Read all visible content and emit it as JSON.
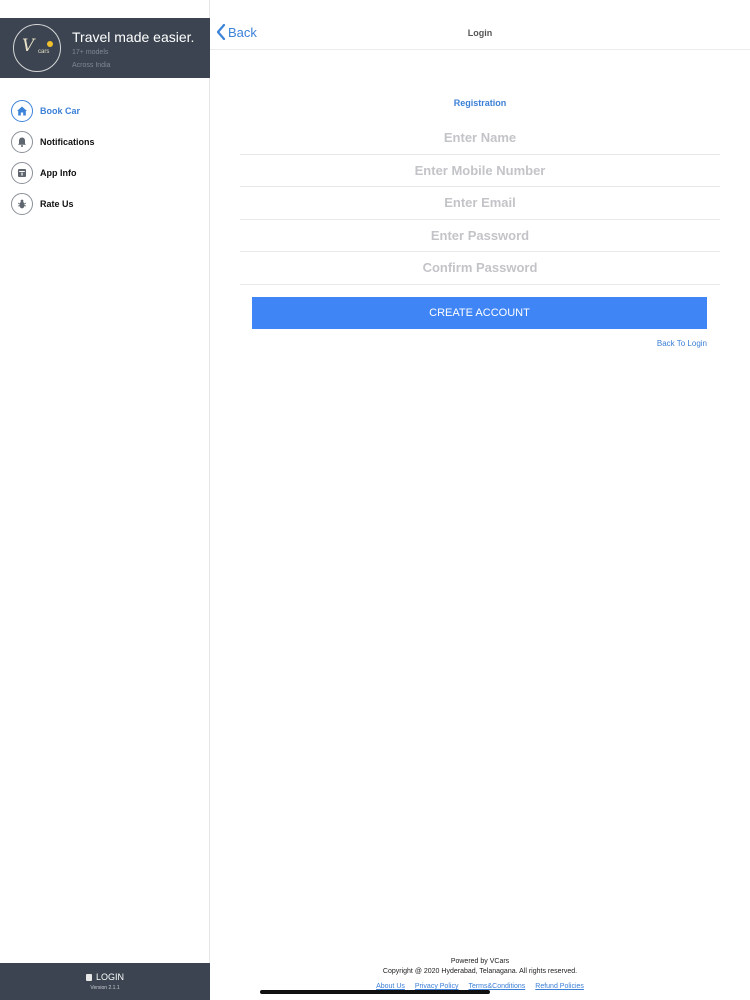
{
  "sidebar": {
    "tagline": "Travel made easier.",
    "subline1": "17+ models",
    "subline2": "Across India",
    "logo": {
      "main": "V",
      "sub": "cars"
    },
    "items": [
      {
        "label": "Book Car",
        "icon": "home-icon"
      },
      {
        "label": "Notifications",
        "icon": "bell-icon"
      },
      {
        "label": "App Info",
        "icon": "info-box-icon"
      },
      {
        "label": "Rate Us",
        "icon": "bug-icon"
      }
    ],
    "footer": {
      "login_label": "LOGIN",
      "version": "Version 2.1.1"
    }
  },
  "navbar": {
    "back_label": "Back",
    "title": "Login"
  },
  "registration": {
    "title": "Registration",
    "fields": [
      {
        "placeholder": "Enter Name",
        "value": ""
      },
      {
        "placeholder": "Enter Mobile Number",
        "value": ""
      },
      {
        "placeholder": "Enter Email",
        "value": ""
      },
      {
        "placeholder": "Enter Password",
        "value": ""
      },
      {
        "placeholder": "Confirm Password",
        "value": ""
      }
    ],
    "create_button": "CREATE ACCOUNT",
    "back_to_login": "Back To Login"
  },
  "footer": {
    "powered": "Powered by VCars",
    "copyright": "Copyright @ 2020 Hyderabad, Telanagana. All rights reserved.",
    "links": [
      "About Us",
      "Privacy Policy",
      "Terms&Conditions",
      "Refund Policies"
    ]
  },
  "colors": {
    "accent": "#3f85f5",
    "link": "#3b7fd6",
    "sidebar_dark": "#3b4450"
  }
}
